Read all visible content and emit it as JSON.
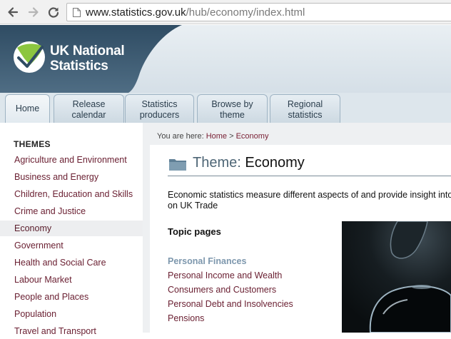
{
  "browser": {
    "url_domain": "www.statistics.gov.uk",
    "url_path": "/hub/economy/index.html",
    "back_icon": "back-arrow-icon",
    "forward_icon": "forward-arrow-icon",
    "reload_icon": "reload-icon",
    "page_icon": "page-icon"
  },
  "header": {
    "logo_line1": "UK National",
    "logo_line2": "Statistics",
    "tabs": [
      {
        "line1": "Home",
        "line2": ""
      },
      {
        "line1": "Release",
        "line2": "calendar"
      },
      {
        "line1": "Statistics",
        "line2": "producers"
      },
      {
        "line1": "Browse by",
        "line2": "theme"
      },
      {
        "line1": "Regional",
        "line2": "statistics"
      }
    ]
  },
  "sidebar": {
    "heading": "THEMES",
    "items": [
      "Agriculture and Environment",
      "Business and Energy",
      "Children, Education and Skills",
      "Crime and Justice",
      "Economy",
      "Government",
      "Health and Social Care",
      "Labour Market",
      "People and Places",
      "Population",
      "Travel and Transport"
    ],
    "active_index": 4
  },
  "breadcrumb": {
    "prefix": "You are here: ",
    "home": "Home",
    "separator": " > ",
    "current": "Economy"
  },
  "main": {
    "title_label": "Theme: ",
    "title_value": "Economy",
    "description_line1": "Economic statistics measure different aspects of and provide insight into",
    "description_line2": "on UK Trade",
    "topic_heading": "Topic pages",
    "section_heading": "Personal Finances",
    "topic_links": [
      "Personal Income and Wealth",
      "Consumers and Customers",
      "Personal Debt and Insolvencies",
      "Pensions"
    ]
  },
  "colors": {
    "header_dark": "#3e5a70",
    "link": "#6b2133",
    "section_heading": "#7d97ad",
    "logo_green": "#8cc63f"
  }
}
